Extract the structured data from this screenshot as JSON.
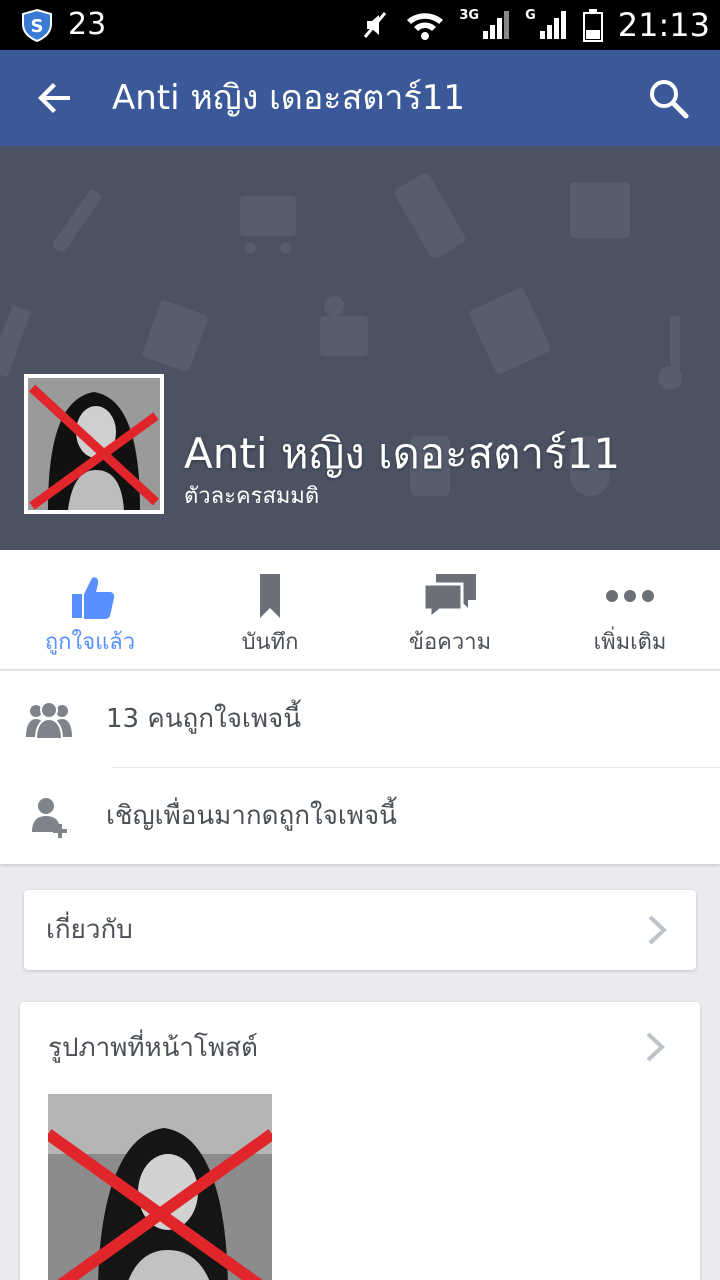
{
  "status_bar": {
    "notification_count": "23",
    "network_3g": "3G",
    "network_g": "G",
    "time": "21:13",
    "icons": [
      "shield-icon",
      "mute-icon",
      "wifi-icon",
      "signal-icon",
      "battery-icon"
    ]
  },
  "app_bar": {
    "title": "Anti หญิง เดอะสตาร์11",
    "back_icon": "arrow-left-icon",
    "search_icon": "search-icon",
    "color": "#3b5998"
  },
  "page": {
    "name": "Anti หญิง เดอะสตาร์11",
    "category": "ตัวละครสมมติ"
  },
  "actions": [
    {
      "label": "ถูกใจแล้ว",
      "icon": "thumbs-up-icon",
      "active": true
    },
    {
      "label": "บันทึก",
      "icon": "bookmark-icon",
      "active": false
    },
    {
      "label": "ข้อความ",
      "icon": "message-icon",
      "active": false
    },
    {
      "label": "เพิ่มเติม",
      "icon": "more-icon",
      "active": false
    }
  ],
  "info": {
    "likes_text": "13 คนถูกใจเพจนี้",
    "invite_text": "เชิญเพื่อนมากดถูกใจเพจนี้"
  },
  "about": {
    "title": "เกี่ยวกับ"
  },
  "photos": {
    "title": "รูปภาพที่หน้าโพสต์"
  },
  "colors": {
    "accent": "#5890ff",
    "brand": "#3b5998",
    "cover": "#4b5363",
    "background": "#e9ebee"
  }
}
